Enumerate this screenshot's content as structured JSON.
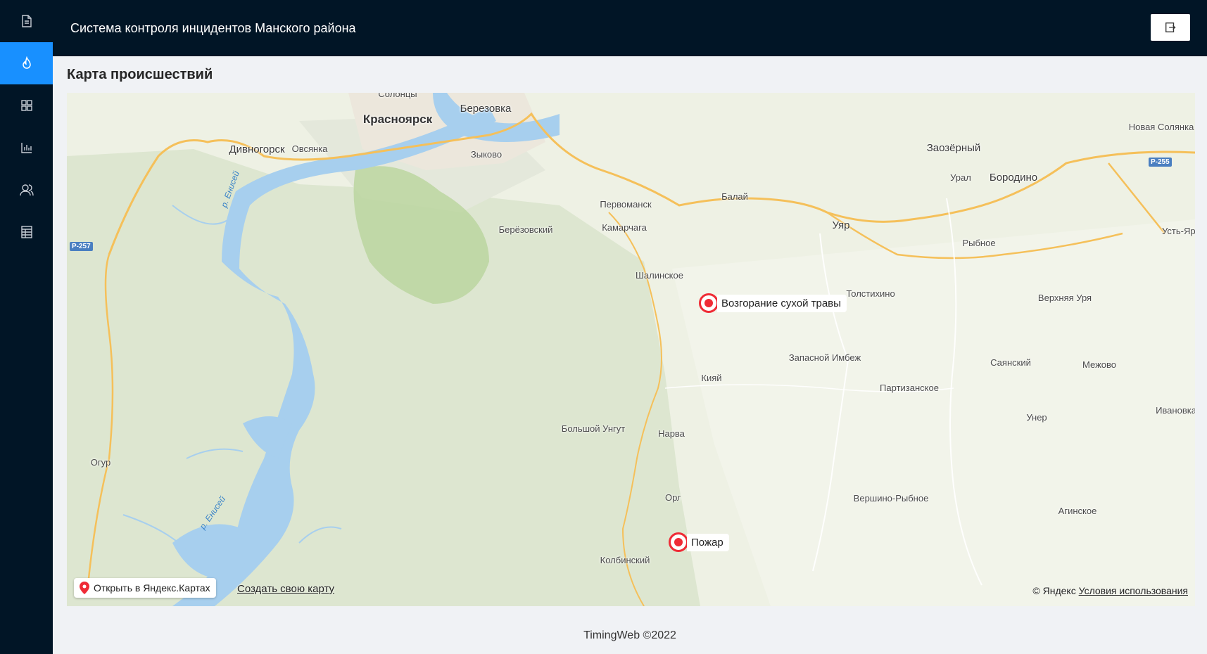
{
  "header": {
    "title": "Система контроля инцидентов Манского района"
  },
  "sidebar": {
    "items": [
      {
        "icon": "document-icon",
        "active": false
      },
      {
        "icon": "fire-icon",
        "active": true
      },
      {
        "icon": "dashboard-icon",
        "active": false
      },
      {
        "icon": "chart-icon",
        "active": false
      },
      {
        "icon": "users-icon",
        "active": false
      },
      {
        "icon": "table-icon",
        "active": false
      }
    ]
  },
  "page": {
    "title": "Карта происшествий"
  },
  "map": {
    "towns": [
      "Солонцы",
      "Красноярск",
      "Березовка",
      "Дивногорск",
      "Овсянка",
      "Зыково",
      "Заозёрный",
      "Новая Солянка",
      "Урал",
      "Бородино",
      "Первоманск",
      "Балай",
      "Берёзовский",
      "Камарчага",
      "Уяр",
      "Рыбное",
      "Усть-Яруль",
      "Шалинское",
      "Толстихино",
      "Верхняя Уря",
      "Запасной Имбеж",
      "Кияй",
      "Саянский",
      "Межово",
      "Партизанское",
      "Унер",
      "Ивановка",
      "Большой Унгут",
      "Нарва",
      "Огур",
      "Орловка",
      "Вершино-Рыбное",
      "Агинское",
      "Колбинский"
    ],
    "river_labels": [
      "р. Енисей",
      "р. Енисей"
    ],
    "road_badges": [
      "Р-257",
      "Р-255"
    ],
    "incidents": [
      {
        "label": "Возгорание сухой травы"
      },
      {
        "label": "Пожар"
      }
    ],
    "open_in_yandex": "Открыть в Яндекс.Картах",
    "create_map": "Создать свою карту",
    "copyright_prefix": "© Яндекс",
    "terms_link": "Условия использования"
  },
  "footer": {
    "text": "TimingWeb ©2022"
  },
  "colors": {
    "nav_bg": "#011526",
    "accent": "#1890ff",
    "incident": "#ef2b36",
    "river": "#a7cfee",
    "road": "#f7c466"
  }
}
